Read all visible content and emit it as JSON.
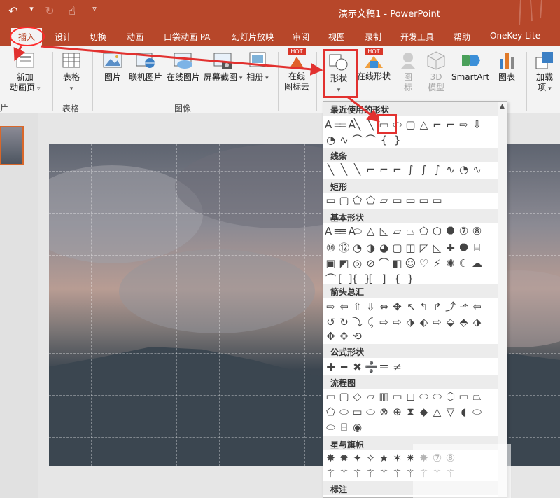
{
  "window": {
    "title": "演示文稿1  -  PowerPoint"
  },
  "qat": {
    "undo": "↶",
    "undo_drop": "▾",
    "redo": "↻",
    "touch": "☝",
    "customize": "▿"
  },
  "tabs": [
    "插入",
    "设计",
    "切换",
    "动画",
    "口袋动画 PA",
    "幻灯片放映",
    "审阅",
    "视图",
    "录制",
    "开发工具",
    "帮助",
    "OneKey Lite"
  ],
  "ribbon": {
    "new_slide": [
      "新加",
      "动画页"
    ],
    "table": "表格",
    "picture": "图片",
    "online_picture_link": "联机图片",
    "online_picture": "在线图片",
    "screenshot": "屏幕截图",
    "album": "相册",
    "icon_cloud": [
      "在线",
      "图标云"
    ],
    "shapes": "形状",
    "online_shapes": "在线形状",
    "icons": [
      "图",
      "标"
    ],
    "model3d": [
      "3D",
      "模型"
    ],
    "smartart": "SmartArt",
    "chart": "图表",
    "addin": [
      "加载",
      "项"
    ],
    "groups": {
      "table": "表格",
      "image": "图像",
      "left": "片"
    },
    "hot": "HOT"
  },
  "gallery": {
    "sections": [
      {
        "title": "最近使用的形状",
        "rows": [
          [
            "A≡",
            "≡A",
            "╲",
            "╲",
            "▭",
            "⬭",
            "▢",
            "△",
            "⌐",
            "⌐",
            "⇨",
            "⇩"
          ],
          [
            "◔",
            "∿",
            "⌒",
            "⌒",
            "{",
            "}"
          ]
        ]
      },
      {
        "title": "线条",
        "rows": [
          [
            "╲",
            "╲",
            "╲",
            "⌐",
            "⌐",
            "⌐",
            "∫",
            "∫",
            "∫",
            "∿",
            "◔",
            "∿"
          ]
        ]
      },
      {
        "title": "矩形",
        "rows": [
          [
            "▭",
            "▢",
            "⬠",
            "⬠",
            "▱",
            "▭",
            "▭",
            "▭",
            "▭"
          ]
        ]
      },
      {
        "title": "基本形状",
        "rows": [
          [
            "A≡",
            "≡A",
            "⬭",
            "△",
            "◺",
            "▱",
            "⏢",
            "⬠",
            "⬡",
            "⯃",
            "⑦",
            "⑧"
          ],
          [
            "⑩",
            "⑫",
            "◔",
            "◑",
            "◕",
            "▢",
            "◫",
            "◸",
            "◺",
            "✚",
            "⯃",
            "⌸"
          ],
          [
            "▣",
            "◩",
            "◎",
            "⊘",
            "⌒",
            "◧",
            "☺",
            "♡",
            "⚡",
            "✺",
            "☾",
            "☁"
          ],
          [
            "⌒",
            "[ ]",
            "{ }",
            "[",
            "]",
            "{",
            "}"
          ]
        ]
      },
      {
        "title": "箭头总汇",
        "rows": [
          [
            "⇨",
            "⇦",
            "⇧",
            "⇩",
            "⇔",
            "✥",
            "⇱",
            "↰",
            "↱",
            "⤴",
            "⬏",
            "⇦"
          ],
          [
            "↺",
            "↻",
            "⤵",
            "⤹",
            "⇨",
            "⇨",
            "⬗",
            "⬖",
            "⇨",
            "⬙",
            "⬘",
            "⬗"
          ],
          [
            "✥",
            "✥",
            "⟲"
          ]
        ]
      },
      {
        "title": "公式形状",
        "rows": [
          [
            "✚",
            "━",
            "✖",
            "➗",
            "＝",
            "≠"
          ]
        ]
      },
      {
        "title": "流程图",
        "rows": [
          [
            "▭",
            "▢",
            "◇",
            "▱",
            "▥",
            "▭",
            "◻",
            "⬭",
            "⬭",
            "⬡",
            "▭",
            "⏢"
          ],
          [
            "⬠",
            "⬭",
            "▭",
            "⬭",
            "⊗",
            "⊕",
            "⧗",
            "◆",
            "△",
            "▽",
            "◖",
            "⬭"
          ],
          [
            "⬭",
            "⌸",
            "◉"
          ]
        ]
      },
      {
        "title": "星与旗帜",
        "rows": [
          [
            "✸",
            "✹",
            "✦",
            "✧",
            "★",
            "✶",
            "✷",
            "✸",
            "⑦",
            "⑧"
          ],
          [
            "⚚",
            "⚚",
            "⚚",
            "⚚",
            "⚚",
            "⚚",
            "⚚",
            "⚚",
            "⚚",
            "⚚"
          ]
        ]
      },
      {
        "title": "标注",
        "rows": [
          [
            "▭",
            "▢",
            "⬭",
            "◇",
            "◸",
            "◺",
            "⬠",
            "⬡",
            "⯃",
            "⬭",
            "⬭"
          ]
        ]
      }
    ]
  }
}
